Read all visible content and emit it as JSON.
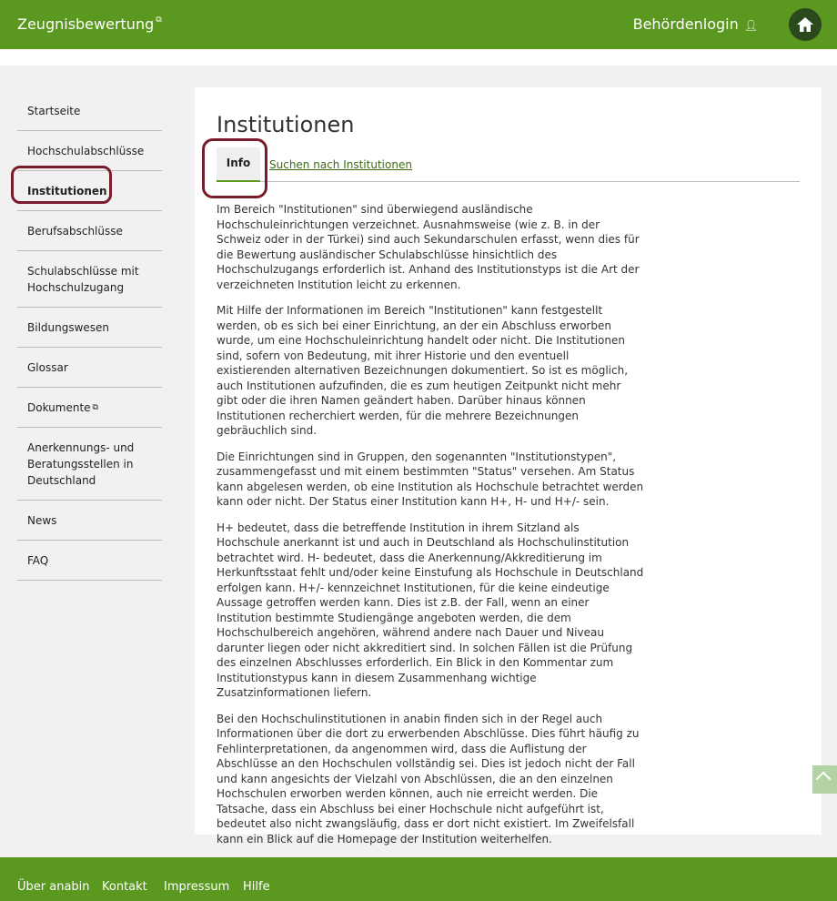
{
  "header": {
    "brand": "Zeugnisbewertung",
    "login": "Behördenlogin"
  },
  "sidebar": {
    "items": [
      {
        "label": "Startseite"
      },
      {
        "label": "Hochschulabschlüsse"
      },
      {
        "label": "Institutionen"
      },
      {
        "label": "Berufsabschlüsse"
      },
      {
        "label": "Schulabschlüsse mit Hochschulzugang"
      },
      {
        "label": "Bildungswesen"
      },
      {
        "label": "Glossar"
      },
      {
        "label": "Dokumente"
      },
      {
        "label": "Anerkennungs- und Beratungsstellen in Deutschland"
      },
      {
        "label": "News"
      },
      {
        "label": "FAQ"
      }
    ]
  },
  "main": {
    "title": "Institutionen",
    "tabs": [
      {
        "label": "Info"
      },
      {
        "label": "Suchen nach Institutionen"
      }
    ],
    "paragraphs": [
      "Im Bereich \"Institutionen\" sind überwiegend ausländische Hochschuleinrichtungen verzeichnet. Ausnahmsweise (wie z. B. in der Schweiz oder in der Türkei) sind auch Sekundarschulen erfasst, wenn dies für die Bewertung ausländischer Schulabschlüsse hinsichtlich des Hochschulzugangs erforderlich ist. Anhand des Institutionstyps ist die Art der verzeichneten Institution leicht zu erkennen.",
      "Mit Hilfe der Informationen im Bereich \"Institutionen\" kann festgestellt werden, ob es sich bei einer Einrichtung, an der ein Abschluss erworben wurde, um eine Hochschuleinrichtung handelt oder nicht. Die Institutionen sind, sofern von Bedeutung, mit ihrer Historie und den eventuell existierenden alternativen Bezeichnungen dokumentiert. So ist es möglich, auch Institutionen aufzufinden, die es zum heutigen Zeitpunkt nicht mehr gibt oder die ihren Namen geändert haben. Darüber hinaus können Institutionen recherchiert werden, für die mehrere Bezeichnungen gebräuchlich sind.",
      "Die Einrichtungen sind in Gruppen, den sogenannten \"Institutionstypen\", zusammengefasst und mit einem bestimmten \"Status\" versehen. Am Status kann abgelesen werden, ob eine Institution als Hochschule betrachtet werden kann oder nicht. Der Status einer Institution kann H+, H- und H+/- sein.",
      "H+ bedeutet, dass die betreffende Institution in ihrem Sitzland als Hochschule anerkannt ist und auch in Deutschland als Hochschulinstitution betrachtet wird. H- bedeutet, dass die Anerkennung/Akkreditierung im Herkunftsstaat fehlt und/oder keine Einstufung als Hochschule in Deutschland erfolgen kann. H+/- kennzeichnet Institutionen, für die keine eindeutige Aussage getroffen werden kann. Dies ist z.B. der Fall, wenn an einer Institution bestimmte Studiengänge angeboten werden, die dem Hochschulbereich angehören, während andere nach Dauer und Niveau darunter liegen oder nicht akkreditiert sind. In solchen Fällen ist die Prüfung des einzelnen Abschlusses erforderlich. Ein Blick in den Kommentar zum Institutionstypus kann in diesem Zusammenhang wichtige Zusatzinformationen liefern.",
      "Bei den Hochschulinstitutionen in anabin finden sich in der Regel auch Informationen über die dort zu erwerbenden Abschlüsse. Dies führt häufig zu Fehlinterpretationen, da angenommen wird, dass die Auflistung der Abschlüsse an den Hochschulen vollständig sei. Dies ist jedoch nicht der Fall und kann angesichts der Vielzahl von Abschlüssen, die an den einzelnen Hochschulen erworben werden können, auch nie erreicht werden. Die Tatsache, dass ein Abschluss bei einer Hochschule nicht aufgeführt ist, bedeutet also nicht zwangsläufig, dass er dort nicht existiert. Im Zweifelsfall kann ein Blick auf die Homepage der Institution weiterhelfen."
    ]
  },
  "footer": {
    "links": [
      {
        "label": "Über anabin"
      },
      {
        "label": "Kontakt"
      },
      {
        "label": "Impressum"
      },
      {
        "label": "Hilfe"
      }
    ]
  },
  "colors": {
    "brand_green": "#5a9820",
    "highlight_ring": "#7a1b2c",
    "home_button": "#2a4a1e"
  },
  "icons": [
    "external-link-icon",
    "person-icon",
    "home-icon",
    "chevron-up-icon"
  ]
}
